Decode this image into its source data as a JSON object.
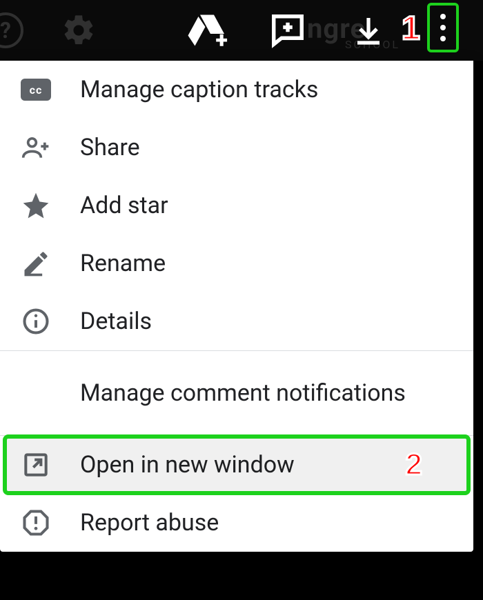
{
  "annotations": {
    "step1": "1",
    "step2": "2"
  },
  "menu": {
    "manage_captions": "Manage caption tracks",
    "share": "Share",
    "add_star": "Add star",
    "rename": "Rename",
    "details": "Details",
    "manage_comment_notifications": "Manage comment notifications",
    "open_new_window": "Open in new window",
    "report_abuse": "Report abuse"
  },
  "icons": {
    "cc": "cc"
  },
  "background_text": {
    "main": "ngre",
    "sub": "SCHOOL"
  }
}
